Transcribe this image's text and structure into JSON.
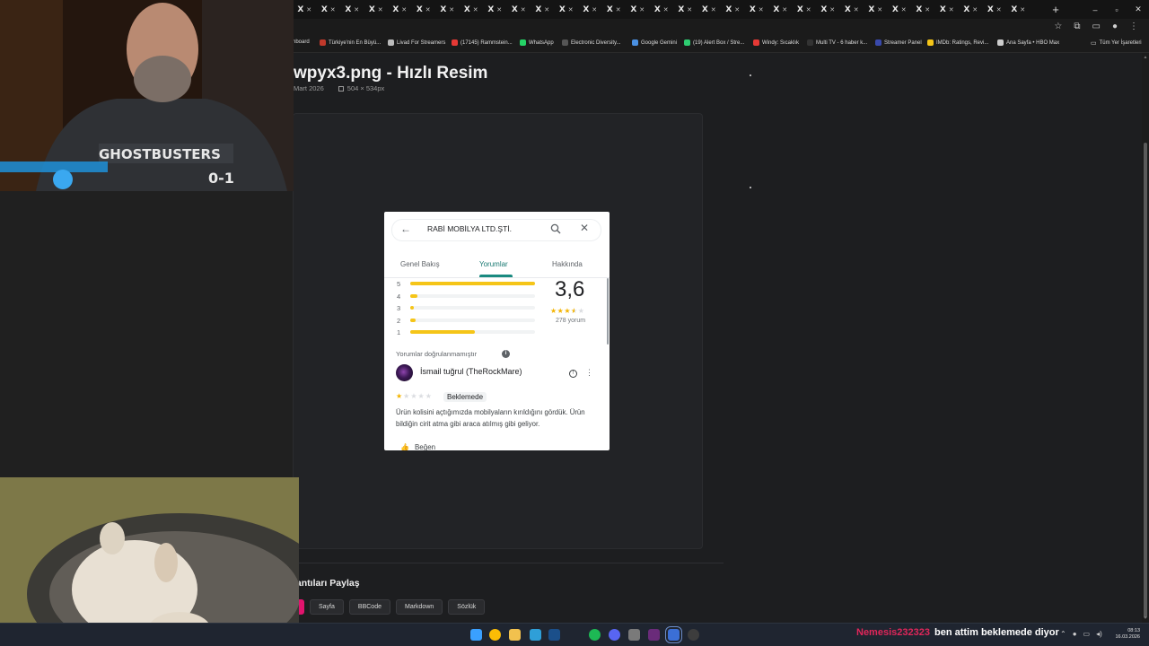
{
  "browser": {
    "tab_count": 31,
    "tab_labels": [
      "X",
      "X",
      "X",
      "X",
      "X",
      "X",
      "X",
      "X",
      "X",
      "X",
      "X",
      "X",
      "X",
      "X",
      "X",
      "X",
      "X",
      "X",
      "X",
      "X",
      "X",
      "X",
      "X",
      "X",
      "X",
      "X",
      "X",
      "X",
      "X",
      "X",
      "X"
    ],
    "new_tab": "+",
    "bookmarks": [
      {
        "label": "hboard",
        "color": "#1b1b1b"
      },
      {
        "label": "Türkiye'nin En Büyü...",
        "color": "#c0392b"
      },
      {
        "label": "Livad For Streamers",
        "color": "#bbbbbb"
      },
      {
        "label": "(17145) Rammstein...",
        "color": "#e53935"
      },
      {
        "label": "WhatsApp",
        "color": "#25d366"
      },
      {
        "label": "Electronic Diversity...",
        "color": "#555555"
      },
      {
        "label": "Google Gemini",
        "color": "#4a90e2"
      },
      {
        "label": "(19) Alert Box / Stre...",
        "color": "#2ecc71"
      },
      {
        "label": "Windy: Sıcaklık",
        "color": "#e53935"
      },
      {
        "label": "Multi TV - 6 haber k...",
        "color": "#333333"
      },
      {
        "label": "Streamer Panel",
        "color": "#3949ab"
      },
      {
        "label": "IMDb: Ratings, Revi...",
        "color": "#f5c518"
      },
      {
        "label": "Ana Sayfa • HBO Max",
        "color": "#cccccc"
      }
    ],
    "all_bookmarks": "Tüm Yer İşaretleri"
  },
  "page": {
    "title": "wpyx3.png - Hızlı Resim",
    "date": "Mart 2026",
    "dimensions": "504 × 534px",
    "share_title": "lantıları Paylaş",
    "share_tabs": [
      "Sayfa",
      "BBCode",
      "Markdown",
      "Sözlük"
    ]
  },
  "card": {
    "business_name": "RABİ MOBİLYA LTD.ŞTİ.",
    "tabs": [
      "Genel Bakış",
      "Yorumlar",
      "Hakkında"
    ],
    "active_tab": "Yorumlar",
    "rating": "3,6",
    "rating_value": 3.6,
    "review_count": "278 yorum",
    "distribution": [
      {
        "stars": "5",
        "fraction": 1.0
      },
      {
        "stars": "4",
        "fraction": 0.06
      },
      {
        "stars": "3",
        "fraction": 0.03
      },
      {
        "stars": "2",
        "fraction": 0.04
      },
      {
        "stars": "1",
        "fraction": 0.52
      }
    ],
    "unverified_note": "Yorumlar doğrulanmamıştır",
    "reviewer": "İsmail tuğrul (TheRockMare)",
    "review_stars": 1,
    "status": "Beklemede",
    "review_text": "Ürün kolisini açtığımızda mobilyaların kırıldığını gördük. Ürün bildiğin cirit atma gibi araca atılmış gibi geliyor.",
    "like_label": "Beğen"
  },
  "taskbar": {
    "chat_user": "Nemesis232323",
    "chat_message": "ben attim beklemede diyor",
    "clock_time": "08:13",
    "clock_date": "16.03.2026",
    "icons": [
      {
        "name": "windows-start-icon",
        "color": "#3aa0ff"
      },
      {
        "name": "chrome-icon",
        "color": "#fbbc05"
      },
      {
        "name": "file-explorer-icon",
        "color": "#f2c14e"
      },
      {
        "name": "edge-icon",
        "color": "#2f9fd8"
      },
      {
        "name": "steam-icon",
        "color": "#1b4f8a"
      },
      {
        "name": "spotify-icon",
        "color": "#1db954"
      },
      {
        "name": "discord-icon",
        "color": "#5865f2"
      },
      {
        "name": "calculator-icon",
        "color": "#7a7a7a"
      },
      {
        "name": "next-app-icon",
        "color": "#6a2b7a"
      },
      {
        "name": "snipping-tool-icon",
        "color": "#3b6fd6"
      },
      {
        "name": "obs-icon",
        "color": "#3d3d3d"
      }
    ]
  }
}
